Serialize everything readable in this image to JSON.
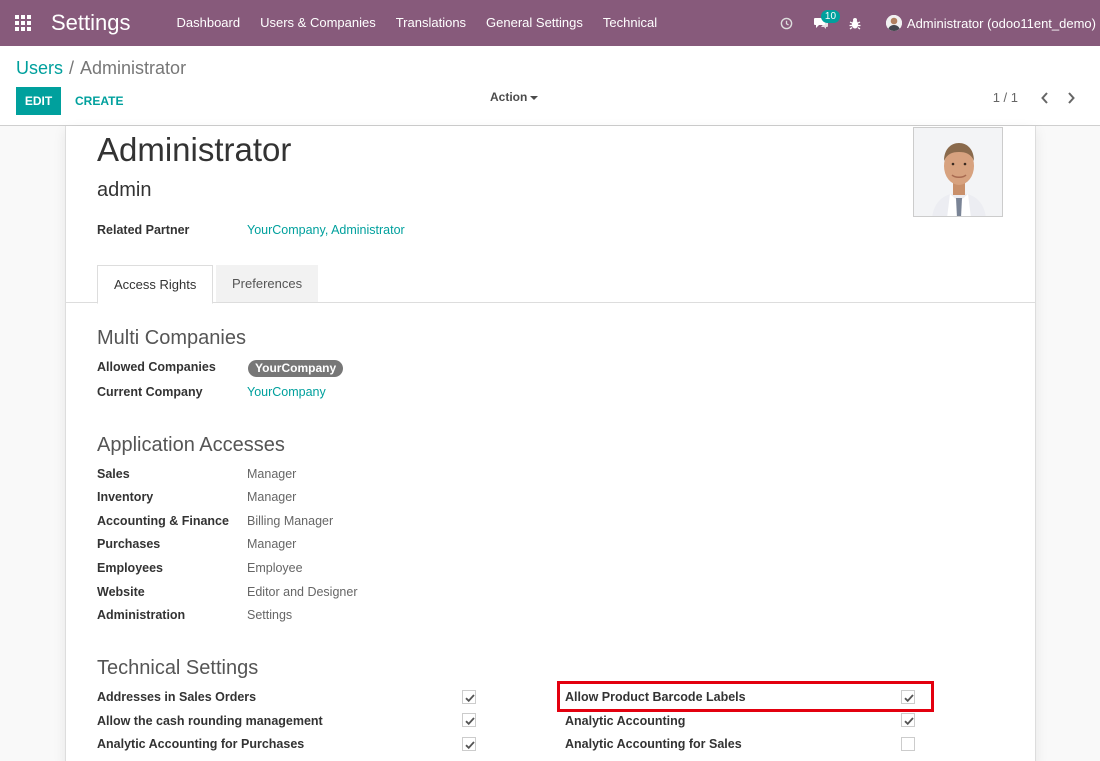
{
  "navbar": {
    "app_title": "Settings",
    "menu": [
      "Dashboard",
      "Users & Companies",
      "Translations",
      "General Settings",
      "Technical"
    ],
    "messages_count": "10",
    "user": "Administrator (odoo11ent_demo)"
  },
  "breadcrumb": {
    "parent": "Users",
    "separator": "/",
    "current": "Administrator"
  },
  "buttons": {
    "edit": "EDIT",
    "create": "CREATE",
    "action": "Action"
  },
  "pager": {
    "value": "1 / 1"
  },
  "form": {
    "name": "Administrator",
    "login": "admin",
    "related_partner_label": "Related Partner",
    "related_partner_value": "YourCompany, Administrator"
  },
  "tabs": {
    "access_rights": "Access Rights",
    "preferences": "Preferences"
  },
  "multi_companies": {
    "title": "Multi Companies",
    "allowed_label": "Allowed Companies",
    "allowed_tag": "YourCompany",
    "current_label": "Current Company",
    "current_value": "YourCompany"
  },
  "app_access": {
    "title": "Application Accesses",
    "rows": [
      {
        "label": "Sales",
        "value": "Manager"
      },
      {
        "label": "Inventory",
        "value": "Manager"
      },
      {
        "label": "Accounting & Finance",
        "value": "Billing Manager"
      },
      {
        "label": "Purchases",
        "value": "Manager"
      },
      {
        "label": "Employees",
        "value": "Employee"
      },
      {
        "label": "Website",
        "value": "Editor and Designer"
      },
      {
        "label": "Administration",
        "value": "Settings"
      }
    ]
  },
  "technical": {
    "title": "Technical Settings",
    "left": [
      {
        "label": "Addresses in Sales Orders",
        "checked": true
      },
      {
        "label": "Allow the cash rounding management",
        "checked": true
      },
      {
        "label": "Analytic Accounting for Purchases",
        "checked": true
      }
    ],
    "right": [
      {
        "label": "Allow Product Barcode Labels",
        "checked": true
      },
      {
        "label": "Analytic Accounting",
        "checked": true
      },
      {
        "label": "Analytic Accounting for Sales",
        "checked": false
      }
    ]
  },
  "colors": {
    "brand": "#875a7b",
    "accent": "#00a09d",
    "highlight": "#e3000f"
  }
}
